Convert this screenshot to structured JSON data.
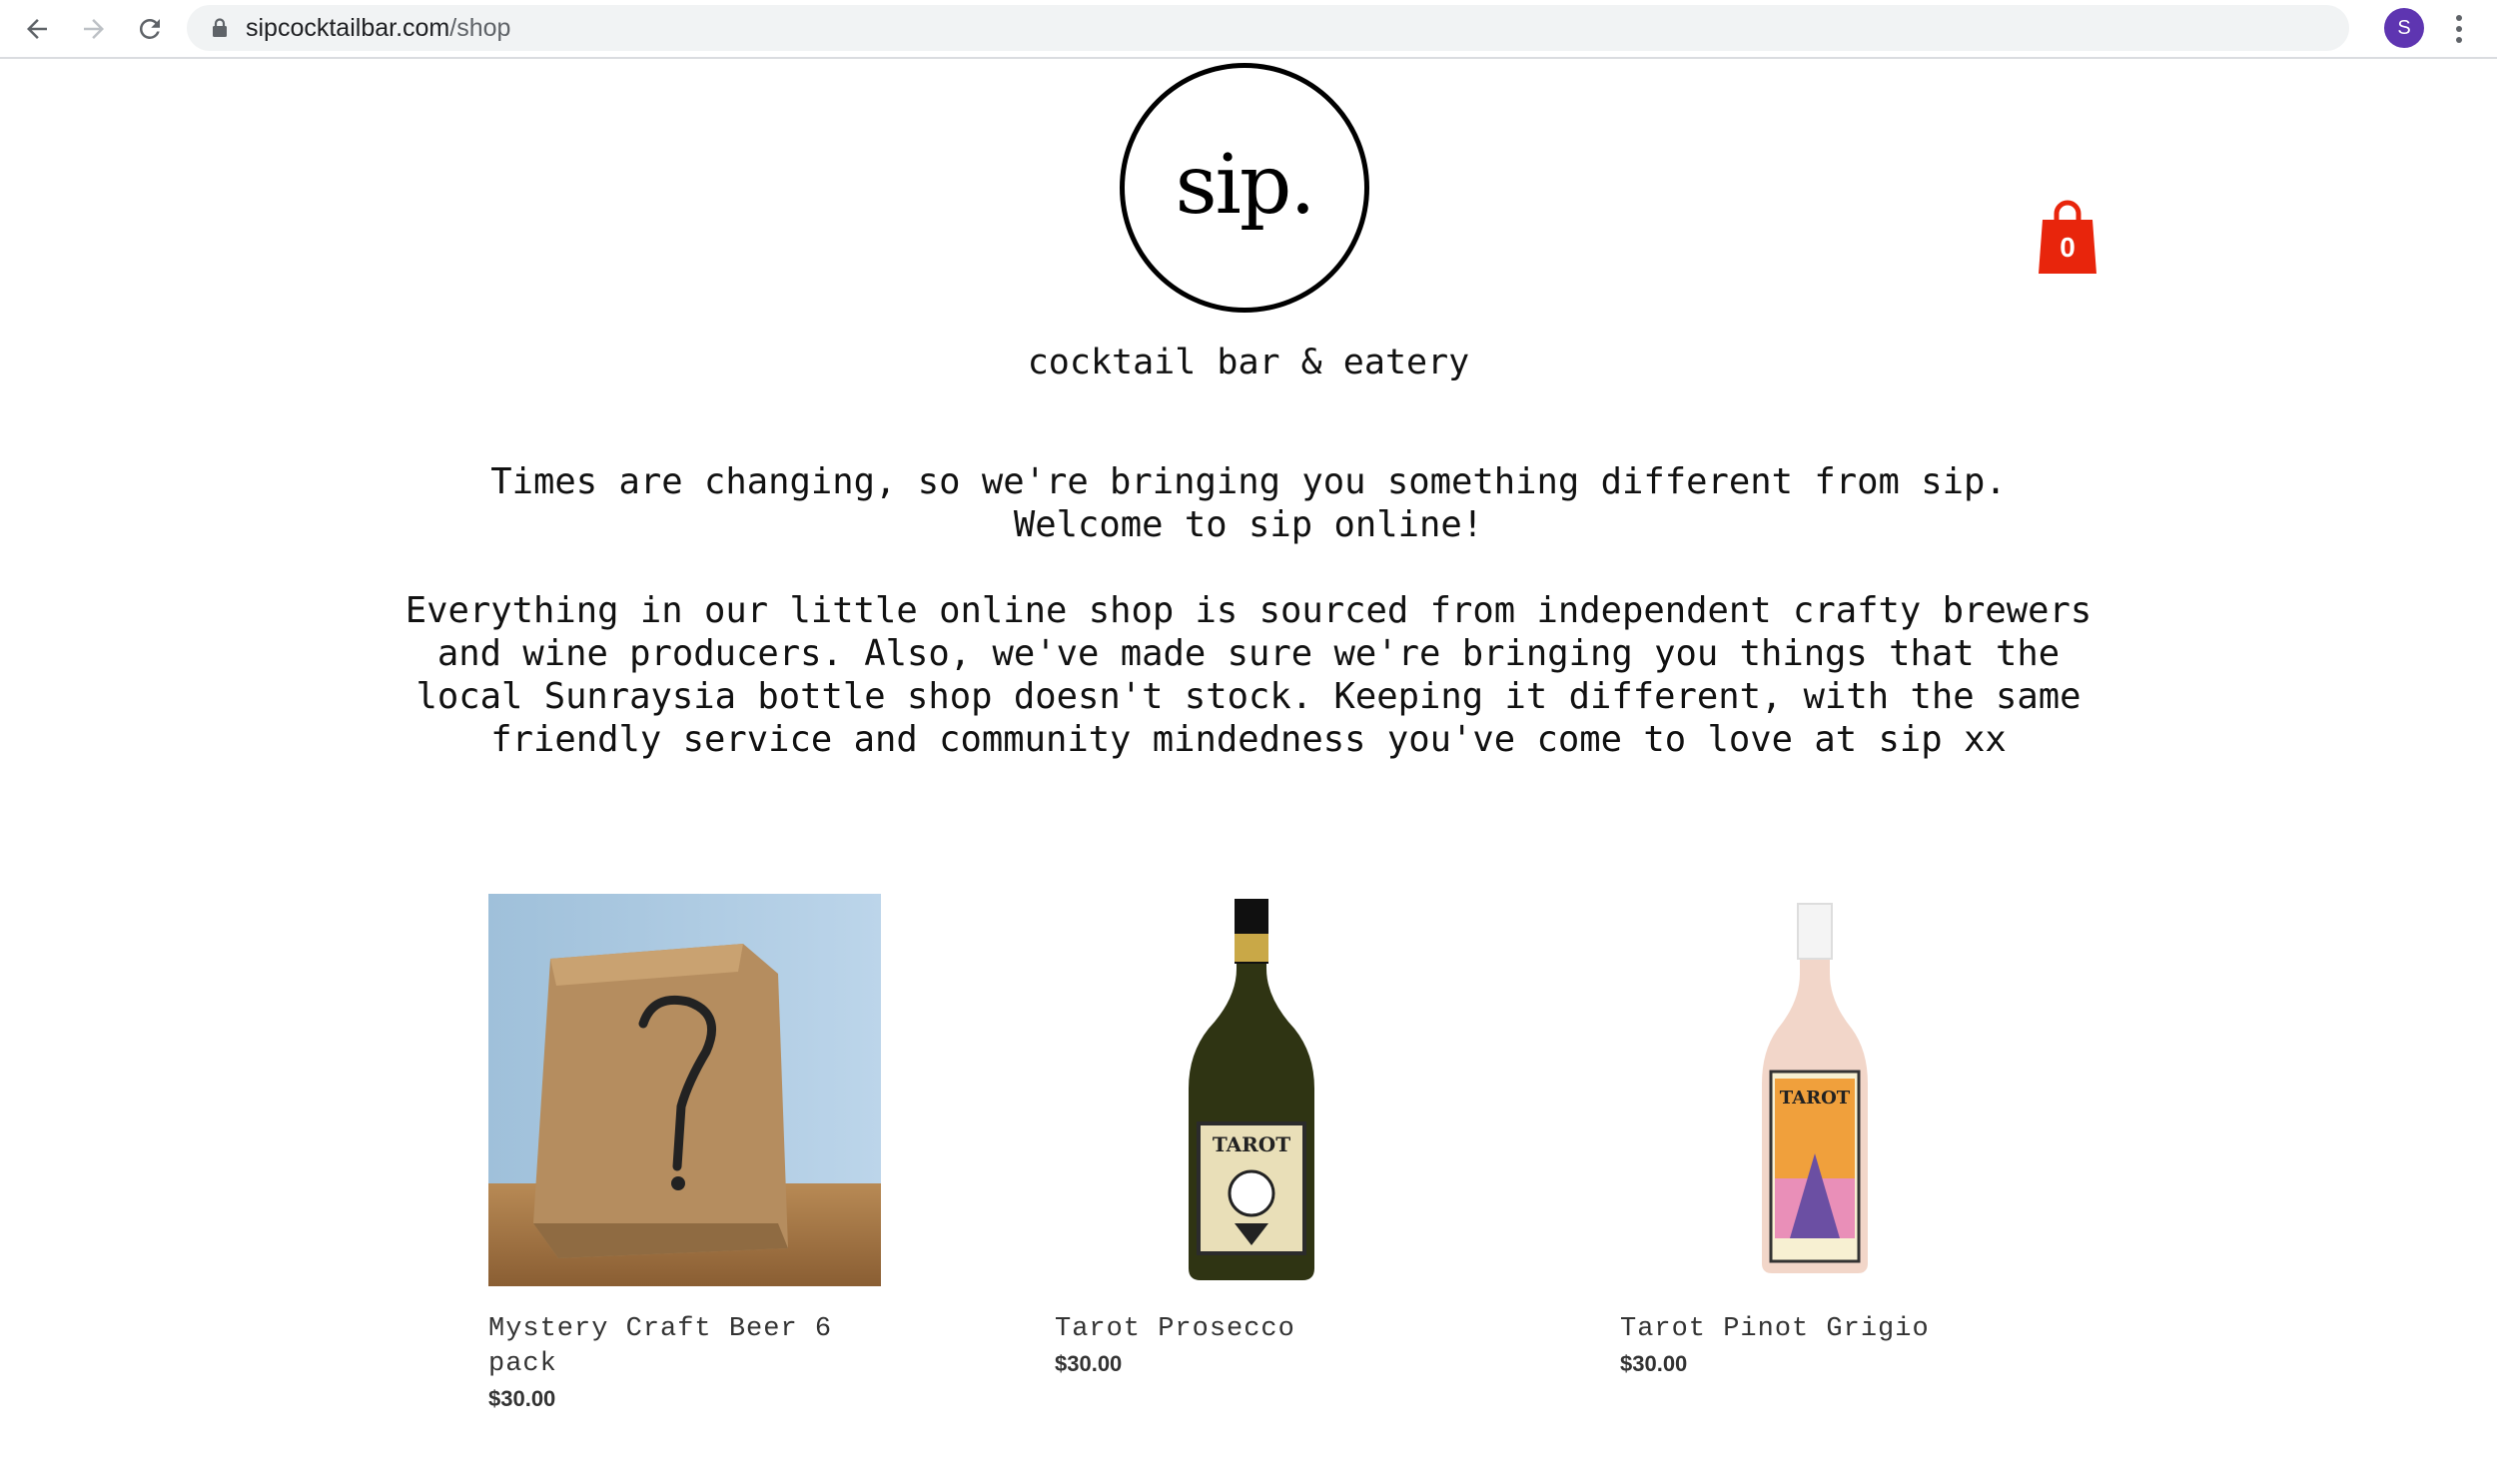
{
  "browser": {
    "url_domain": "sipcocktailbar.com",
    "url_path": "/shop",
    "profile_initial": "S"
  },
  "header": {
    "logo_text": "sip.",
    "tagline": "cocktail bar & eatery",
    "cart_count": "0"
  },
  "intro": {
    "line1": "Times are changing, so we're bringing you something different from sip.",
    "line2": "Welcome to sip online!",
    "para": [
      "Everything in our little online shop is sourced from independent crafty brewers",
      "and wine producers. Also, we've made sure we're bringing you things that the",
      "local Sunraysia bottle shop doesn't stock. Keeping it different, with the same",
      "friendly service and community mindedness you've come to love at sip xx"
    ]
  },
  "products": [
    {
      "name": "Mystery Craft Beer 6 pack",
      "price": "$30.00"
    },
    {
      "name": "Tarot Prosecco",
      "price": "$30.00",
      "label": "TAROT"
    },
    {
      "name": "Tarot Pinot Grigio",
      "price": "$30.00",
      "label": "TAROT"
    }
  ],
  "colors": {
    "cart": "#e8250c",
    "avatar": "#5e35b1"
  },
  "icons": [
    "back-icon",
    "forward-icon",
    "reload-icon",
    "lock-icon",
    "star-icon",
    "kebab-menu-icon",
    "shopping-bag-icon"
  ]
}
